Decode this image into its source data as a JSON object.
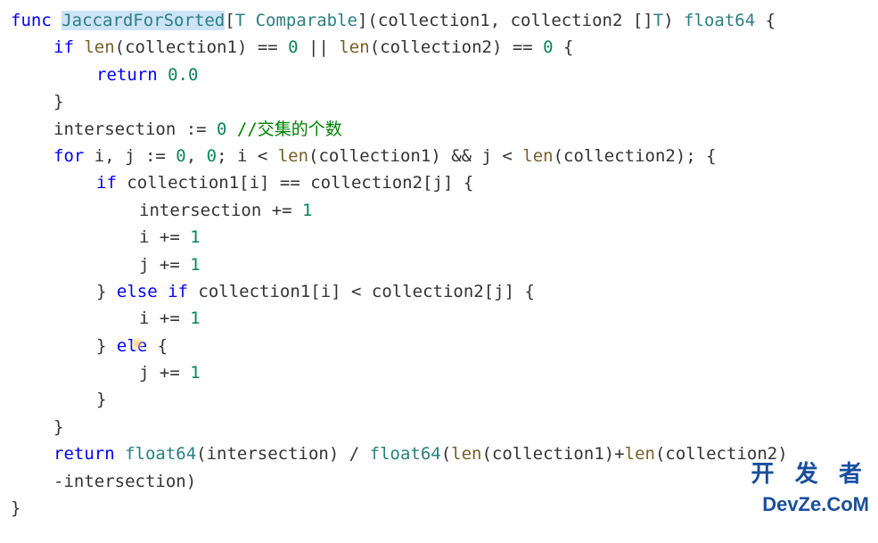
{
  "code": {
    "l1": {
      "kw_func": "func",
      "func_name": "JaccardForSorted",
      "type_param": "T Comparable",
      "params": "collection1, collection2 []",
      "param_type": "T",
      "ret_type": "float64",
      "brace": " {"
    },
    "l2": {
      "kw_if": "if",
      "len1": "len",
      "arg1": "(collection1) == ",
      "zero1": "0",
      "or": " || ",
      "len2": "len",
      "arg2": "(collection2) == ",
      "zero2": "0",
      "brace": " {"
    },
    "l3": {
      "kw_return": "return",
      "val": "0.0"
    },
    "l4": {
      "brace": "}"
    },
    "l5": {
      "var": "intersection := ",
      "zero": "0",
      "comment": " //交集的个数"
    },
    "l6": {
      "kw_for": "for",
      "init": " i, j := ",
      "z1": "0",
      "comma": ", ",
      "z2": "0",
      "cond1": "; i < ",
      "len1": "len",
      "arg1": "(collection1) && j < ",
      "len2": "len",
      "arg2": "(collection2); {"
    },
    "l7": {
      "kw_if": "if",
      "cond": " collection1[i] == collection2[j] {"
    },
    "l8": {
      "stmt": "intersection += ",
      "num": "1"
    },
    "l9": {
      "stmt": "i += ",
      "num": "1"
    },
    "l10": {
      "stmt": "j += ",
      "num": "1"
    },
    "l11": {
      "close": "} ",
      "kw_else": "else",
      "kw_if": " if",
      "cond": " collection1[i] < collection2[j] {"
    },
    "l12": {
      "stmt": "i += ",
      "num": "1"
    },
    "l13": {
      "close": "} ",
      "kw_else_pre": "el",
      "kw_else_post": "e",
      "brace": " {"
    },
    "l14": {
      "stmt": "j += ",
      "num": "1"
    },
    "l15": {
      "brace": "}"
    },
    "l16": {
      "brace": "}"
    },
    "l17": {
      "kw_return": "return",
      "cast1": " float64",
      "arg1": "(intersection) / ",
      "cast2": "float64",
      "arg2_pre": "(",
      "len1": "len",
      "arg2_mid": "(collection1)+",
      "len2": "len",
      "arg2_end": "(collection2)"
    },
    "l18": {
      "cont": "-intersection)"
    },
    "l19": {
      "brace": "}"
    }
  },
  "watermark": {
    "top": "开 发 者",
    "bottom": "DevZe.CoM"
  }
}
